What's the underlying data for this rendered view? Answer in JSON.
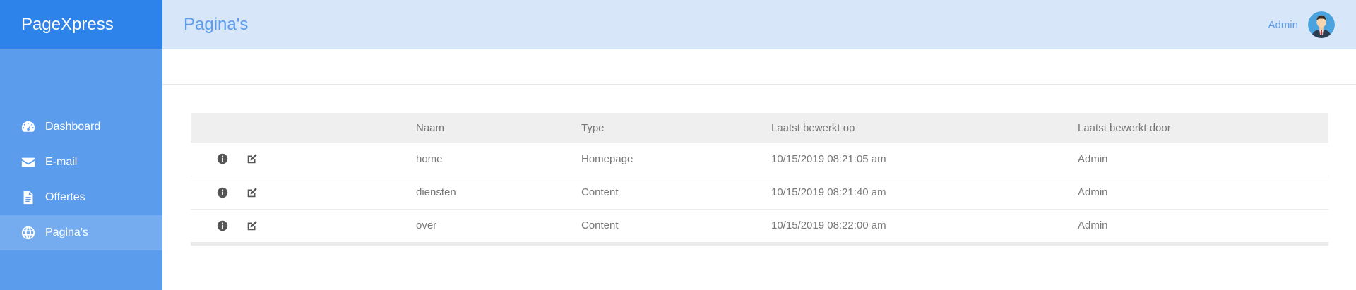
{
  "app": {
    "brand": "PageXpress"
  },
  "sidebar": {
    "items": [
      {
        "label": "Dashboard",
        "icon": "dashboard-gauge-icon",
        "active": false
      },
      {
        "label": "E-mail",
        "icon": "envelope-icon",
        "active": false
      },
      {
        "label": "Offertes",
        "icon": "document-icon",
        "active": false
      },
      {
        "label": "Pagina's",
        "icon": "globe-icon",
        "active": true
      }
    ]
  },
  "header": {
    "title": "Pagina's",
    "user_name": "Admin",
    "avatar_icon": "user-avatar-icon"
  },
  "colors": {
    "brand_bar": "#2d83ea",
    "sidebar": "#5b9cec",
    "topbar": "#d7e6f8",
    "accent_text": "#5b9cec"
  },
  "table": {
    "columns": [
      "",
      "Naam",
      "Type",
      "Laatst bewerkt op",
      "Laatst bewerkt door"
    ],
    "rows": [
      {
        "naam": "home",
        "type": "Homepage",
        "edited_on": "10/15/2019 08:21:05 am",
        "edited_by": "Admin"
      },
      {
        "naam": "diensten",
        "type": "Content",
        "edited_on": "10/15/2019 08:21:40 am",
        "edited_by": "Admin"
      },
      {
        "naam": "over",
        "type": "Content",
        "edited_on": "10/15/2019 08:22:00 am",
        "edited_by": "Admin"
      }
    ],
    "row_action_icons": [
      "info-icon",
      "edit-icon"
    ]
  }
}
